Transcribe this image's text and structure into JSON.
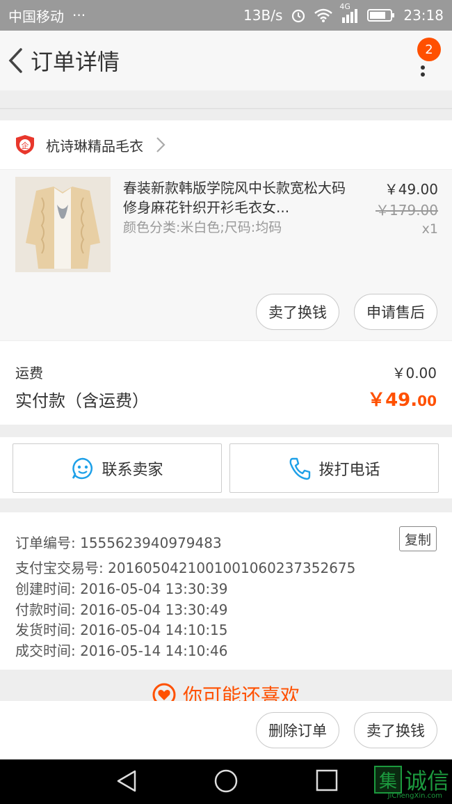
{
  "status_bar": {
    "carrier": "中国移动",
    "dots": "···",
    "speed": "13B/s",
    "network": "4G",
    "time": "23:18"
  },
  "nav": {
    "title": "订单详情",
    "badge_count": "2"
  },
  "shop": {
    "name": "杭诗琳精品毛衣"
  },
  "product": {
    "title": "春装新款韩版学院风中长款宽松大码修身麻花针织开衫毛衣女...",
    "sku": "颜色分类:米白色;尺码:均码",
    "price": "￥49.00",
    "original_price": "￥179.00",
    "quantity": "x1",
    "actions": {
      "sell": "卖了换钱",
      "after_sale": "申请售后"
    }
  },
  "totals": {
    "shipping_label": "运费",
    "shipping_value": "￥0.00",
    "paid_label": "实付款（含运费）",
    "paid_int": "￥49.",
    "paid_dec": "00"
  },
  "contact": {
    "seller": "联系卖家",
    "call": "拨打电话"
  },
  "order_info": {
    "order_no": "订单编号: 1555623940979483",
    "copy": "复制",
    "alipay_no": "支付宝交易号: 2016050421001001060237352675",
    "created": "创建时间: 2016-05-04 13:30:39",
    "paid": "付款时间: 2016-05-04 13:30:49",
    "shipped": "发货时间: 2016-05-04 14:10:15",
    "completed": "成交时间: 2016-05-14 14:10:46"
  },
  "recommend": {
    "label": "你可能还喜欢"
  },
  "bottom_actions": {
    "delete": "删除订单",
    "sell": "卖了换钱"
  },
  "watermark": {
    "logo_char": "集",
    "text": "诚信",
    "sub": "JiChengXin.com"
  },
  "colors": {
    "accent": "#ff5000",
    "contact_icon": "#1ea0e8"
  }
}
